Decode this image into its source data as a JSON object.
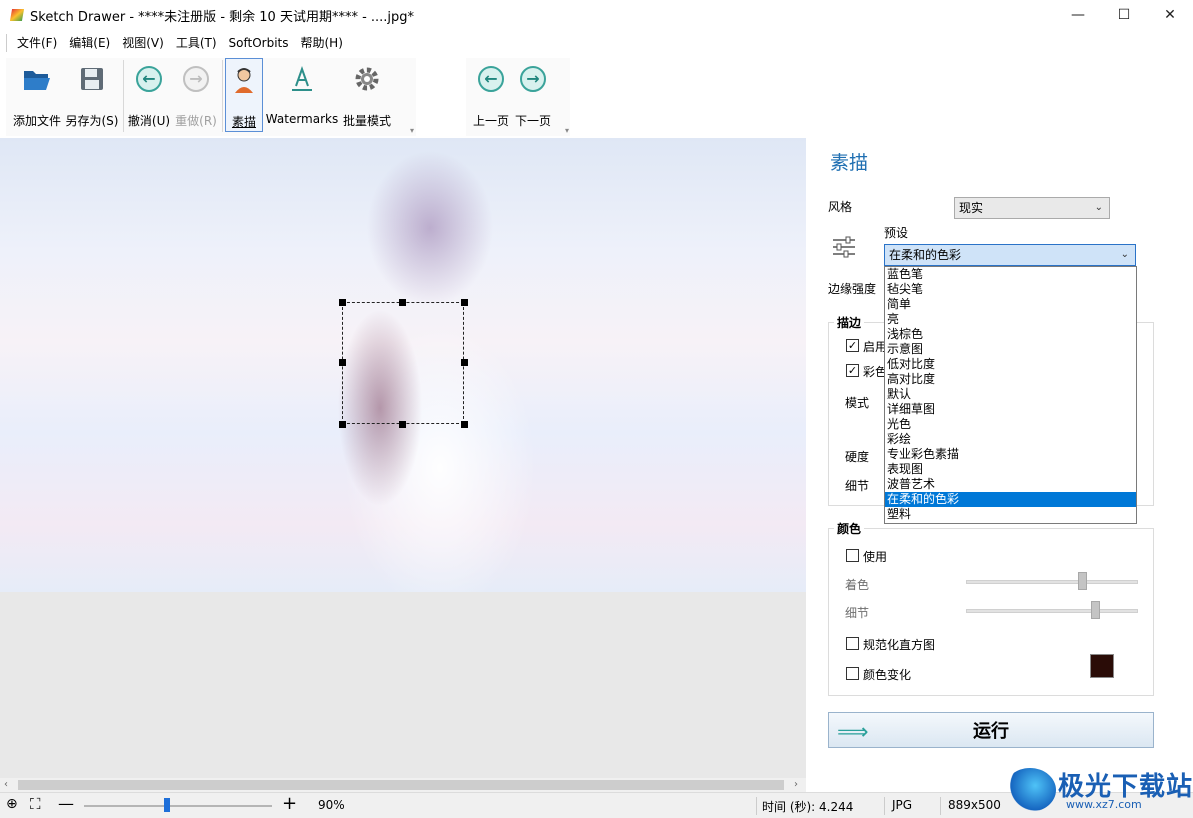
{
  "window": {
    "title": "Sketch Drawer - ****未注册版 - 剩余 10 天试用期**** - ....jpg*",
    "minimize": "—",
    "maximize": "☐",
    "close": "✕"
  },
  "menu": [
    "文件(F)",
    "编辑(E)",
    "视图(V)",
    "工具(T)",
    "SoftOrbits",
    "帮助(H)"
  ],
  "toolbar": {
    "add_file": "添加文件",
    "save_as": "另存为(S)",
    "undo": "撤消(U)",
    "redo": "重做(R)",
    "sketch": "素描",
    "watermarks": "Watermarks",
    "batch": "批量模式",
    "prev": "上一页",
    "next": "下一页"
  },
  "panel": {
    "title": "素描",
    "style_label": "风格",
    "style_value": "现实",
    "preset_label": "预设",
    "preset_value": "在柔和的色彩",
    "edge_label": "边缘强度",
    "stroke_group": "描边",
    "enable_label": "启用",
    "color_label": "彩色",
    "mode_label": "模式",
    "hardness_label": "硬度",
    "detail_label": "细节",
    "color_group": "颜色",
    "use_label": "使用",
    "tint_label": "着色",
    "detail2_label": "细节",
    "normalize_label": "规范化直方图",
    "color_change_label": "颜色变化",
    "run_label": "运行",
    "swatch_color": "#2a0c07"
  },
  "preset_options": [
    "蓝色笔",
    "毡尖笔",
    "简单",
    "亮",
    "浅棕色",
    "示意图",
    "低对比度",
    "高对比度",
    "默认",
    "详细草图",
    "光色",
    "彩绘",
    "专业彩色素描",
    "表现图",
    "波普艺术",
    "在柔和的色彩",
    "塑料"
  ],
  "preset_selected_index": 15,
  "status": {
    "zoom": "90%",
    "time": "时间 (秒): 4.244",
    "format": "JPG",
    "size": "889x500"
  },
  "watermark": {
    "text": "极光下载站",
    "url": "www.xz7.com"
  },
  "colors": {
    "accent": "#1f6fb2",
    "selection": "#0078d7",
    "teal": "#3aa39a"
  }
}
